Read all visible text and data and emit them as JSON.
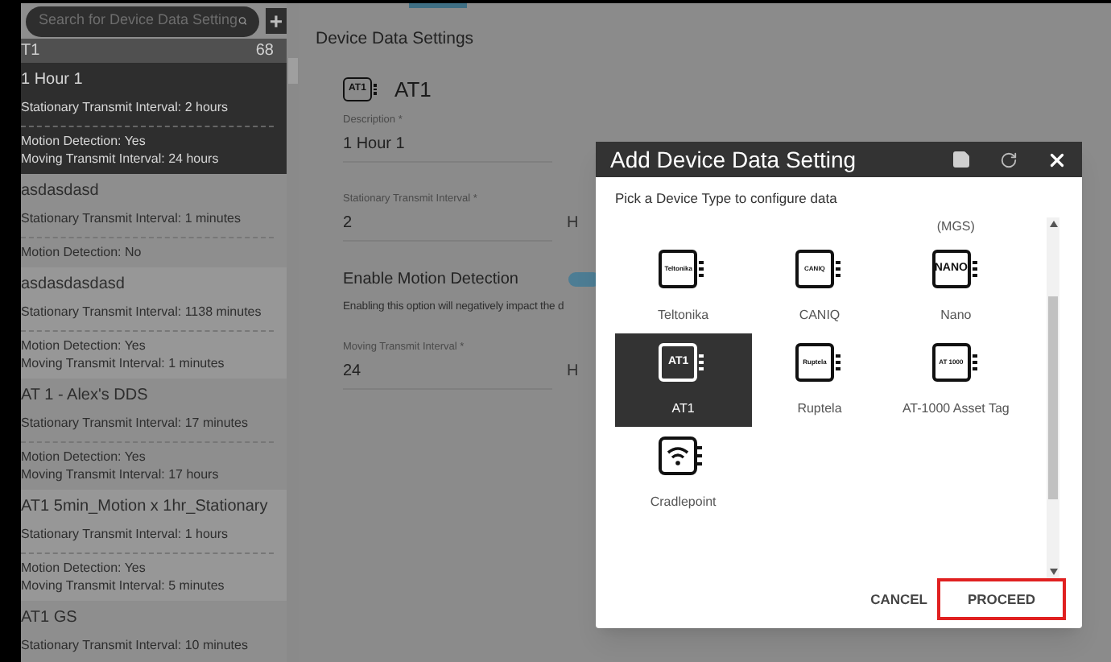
{
  "sidebar": {
    "search": {
      "placeholder": "Search for Device Data Setting"
    },
    "add_button": "+",
    "group": {
      "name": "T1",
      "count": "68"
    },
    "items": [
      {
        "name": "1 Hour 1",
        "stationary": "Stationary Transmit Interval: 2 hours",
        "motion": "Motion Detection: Yes",
        "moving": "Moving Transmit Interval: 24 hours",
        "selected": true
      },
      {
        "name": "asdasdasd",
        "stationary": "Stationary Transmit Interval: 1 minutes",
        "motion": "Motion Detection: No",
        "selected": false
      },
      {
        "name": "asdasdasdasd",
        "stationary": "Stationary Transmit Interval: 1138 minutes",
        "motion": "Motion Detection: Yes",
        "moving": "Moving Transmit Interval: 1 minutes",
        "selected": false
      },
      {
        "name": "AT 1 - Alex's DDS",
        "stationary": "Stationary Transmit Interval: 17 minutes",
        "motion": "Motion Detection: Yes",
        "moving": "Moving Transmit Interval: 17 hours",
        "selected": false
      },
      {
        "name": "AT1 5min_Motion x 1hr_Stationary",
        "stationary": "Stationary Transmit Interval: 1 hours",
        "motion": "Motion Detection: Yes",
        "moving": "Moving Transmit Interval: 5 minutes",
        "selected": false
      },
      {
        "name": "AT1 GS",
        "stationary": "Stationary Transmit Interval: 10 minutes",
        "selected": false
      }
    ]
  },
  "main": {
    "title": "Device Data Settings",
    "device": {
      "icon_text": "AT1",
      "name": "AT1"
    },
    "description": {
      "label": "Description *",
      "value": "1 Hour 1"
    },
    "stationary": {
      "label": "Stationary Transmit Interval *",
      "value": "2",
      "unit": "H"
    },
    "motion": {
      "label": "Enable Motion Detection",
      "on": true,
      "hint": "Enabling this option will negatively impact the d"
    },
    "moving": {
      "label": "Moving Transmit Interval *",
      "value": "24",
      "unit": "H"
    }
  },
  "dialog": {
    "title": "Add Device Data Setting",
    "prompt": "Pick a Device Type to configure data",
    "device_types": [
      {
        "kind": "partial"
      },
      {
        "kind": "partial"
      },
      {
        "kind": "partial",
        "label": "(MGS)"
      },
      {
        "kind": "chip",
        "icon_text": "Teltonika",
        "label": "Teltonika",
        "selected": false
      },
      {
        "kind": "chip",
        "icon_text": "CANIQ",
        "label": "CANIQ",
        "selected": false
      },
      {
        "kind": "chip",
        "icon_text": "NANO",
        "label": "Nano",
        "selected": false
      },
      {
        "kind": "chip",
        "icon_text": "AT1",
        "label": "AT1",
        "selected": true
      },
      {
        "kind": "chip",
        "icon_text": "Ruptela",
        "label": "Ruptela",
        "selected": false
      },
      {
        "kind": "chip",
        "icon_text": "AT 1000",
        "label": "AT-1000 Asset Tag",
        "selected": false
      },
      {
        "kind": "wifi",
        "label": "Cradlepoint",
        "selected": false
      }
    ],
    "buttons": [
      {
        "label": "CANCEL",
        "highlighted": false
      },
      {
        "label": "PROCEED",
        "highlighted": true
      }
    ]
  }
}
